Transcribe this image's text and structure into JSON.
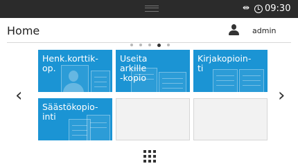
{
  "status_bar": {
    "usb_icon": "usb-icon",
    "clock_icon": "clock-icon",
    "time": "09:30"
  },
  "header": {
    "title": "Home",
    "user_icon": "user-icon",
    "user_name": "admin"
  },
  "pager": {
    "page_count": 5,
    "active_page": 4
  },
  "nav": {
    "prev": "‹",
    "next": "›"
  },
  "tiles": [
    {
      "label": "Henk.korttik-\nop.",
      "icon": "id-card-copy-icon"
    },
    {
      "label": "Useita\narkille\n-kopio",
      "icon": "nup-copy-icon"
    },
    {
      "label": "Kirjakopioin-\nti",
      "icon": "book-copy-icon"
    },
    {
      "label": "Säästökopio-\ninti",
      "icon": "eco-copy-icon"
    },
    {
      "label": "",
      "icon": ""
    },
    {
      "label": "",
      "icon": ""
    }
  ],
  "colors": {
    "tile_blue": "#1b94d4",
    "status_bar": "#2b2b2b"
  },
  "footer": {
    "apps_icon": "apps-grid-icon"
  }
}
